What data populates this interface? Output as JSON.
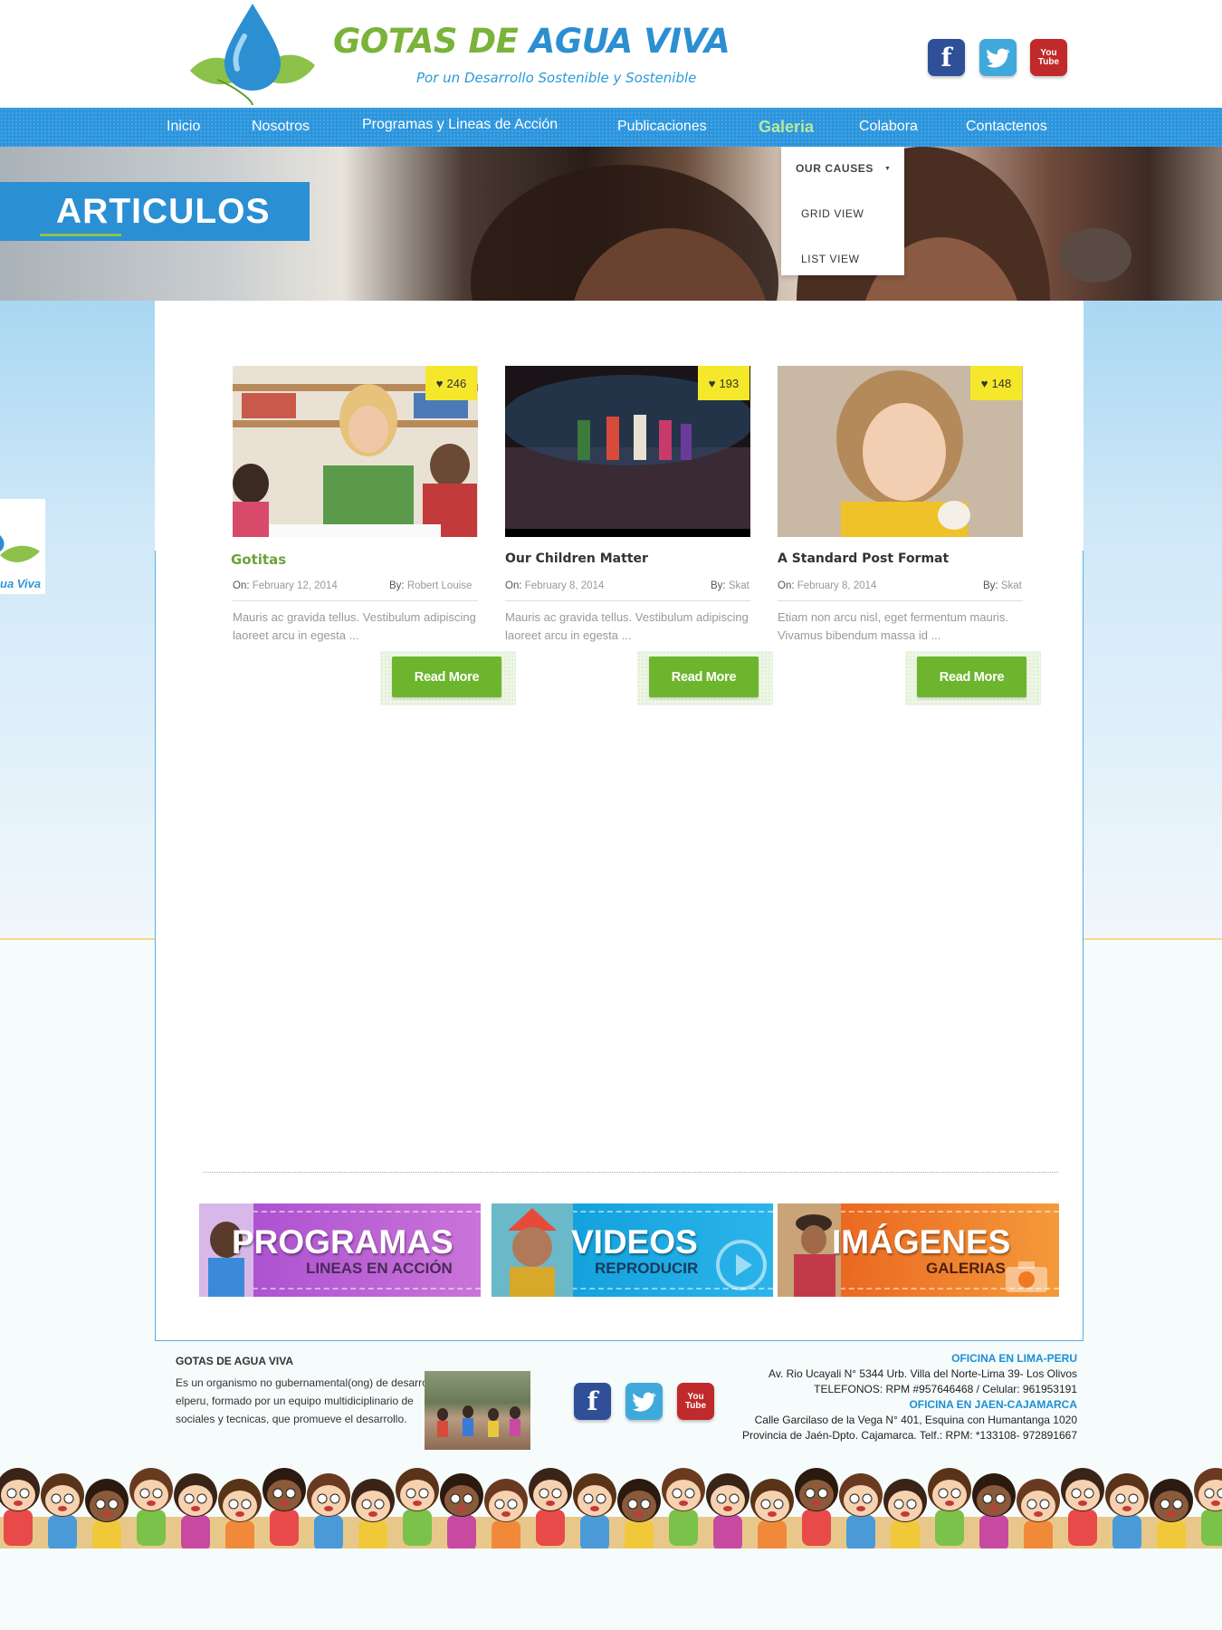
{
  "header": {
    "title_part1": "GOTAS DE",
    "title_part2": "AGUA VIVA",
    "tagline": "Por un Desarrollo Sostenible y Sostenible",
    "social": {
      "facebook": "f",
      "twitter": "twitter-bird",
      "youtube_top": "You",
      "youtube_bottom": "Tube"
    }
  },
  "nav": {
    "items": [
      "Inicio",
      "Nosotros",
      "Programas y Lineas de Acción",
      "Publicaciones",
      "Galeria",
      "Colabora",
      "Contactenos"
    ],
    "active": "Galeria"
  },
  "dropdown": {
    "items": [
      "OUR CAUSES",
      "GRID VIEW",
      "LIST VIEW"
    ],
    "caret": "▼"
  },
  "hero": {
    "title": "ARTICULOS"
  },
  "side_logo": {
    "text": "ua Viva"
  },
  "cards": [
    {
      "title": "Gotitas",
      "likes": "246",
      "on_label": "On:",
      "date": "February 12, 2014",
      "by_label": "By:",
      "author": "Robert Louise",
      "excerpt": "Mauris ac gravida tellus. Vestibulum adipiscing laoreet arcu in egesta ...",
      "button": "Read More",
      "title_color": "#6ea13a"
    },
    {
      "title": "Our Children Matter",
      "likes": "193",
      "on_label": "On:",
      "date": "February 8, 2014",
      "by_label": "By:",
      "author": "Skat",
      "excerpt": "Mauris ac gravida tellus. Vestibulum adipiscing laoreet arcu in egesta ...",
      "button": "Read More",
      "title_color": "#333333"
    },
    {
      "title": "A Standard Post Format",
      "likes": "148",
      "on_label": "On:",
      "date": "February 8, 2014",
      "by_label": "By:",
      "author": "Skat",
      "excerpt": "Etiam non arcu nisl, eget fermentum mauris. Vivamus bibendum massa id ...",
      "button": "Read More",
      "title_color": "#333333"
    }
  ],
  "banners": [
    {
      "big": "PROGRAMAS",
      "small": "LINEAS EN ACCIÓN",
      "color": "#b15ad0"
    },
    {
      "big": "VIDEOS",
      "small": "REPRODUCIR",
      "color": "#1aa6e0"
    },
    {
      "big": "IMÁGENES",
      "small": "GALERIAS",
      "color": "#f07a24"
    }
  ],
  "footer": {
    "org_title": "GOTAS DE AGUA VIVA",
    "description_lines": [
      "Es un organismo no gubernamental(ong) de desarrollo",
      "elperu, formado por un equipo multidiciplinario de",
      "sociales y tecnicas, que promueve el desarrollo."
    ],
    "offices": [
      {
        "heading": "OFICINA EN LIMA-PERU",
        "lines": [
          "Av. Rio Ucayali N° 5344 Urb. Villa del Norte-Lima 39- Los Olivos",
          "TELEFONOS: RPM #957646468 / Celular: 961953191"
        ]
      },
      {
        "heading": "OFICINA EN JAEN-CAJAMARCA",
        "lines": [
          "Calle Garcilaso de la Vega N° 401, Esquina con Humantanga 1020",
          "Provincia de Jaén-Dpto. Cajamarca. Telf.: RPM: *133108- 972891667"
        ]
      }
    ]
  },
  "colors": {
    "nav_blue": "#2b95dd",
    "brand_green": "#7ab33a",
    "brand_blue": "#2b8fd1",
    "button_green": "#6cb52d",
    "likes_yellow": "#f5e82a"
  }
}
